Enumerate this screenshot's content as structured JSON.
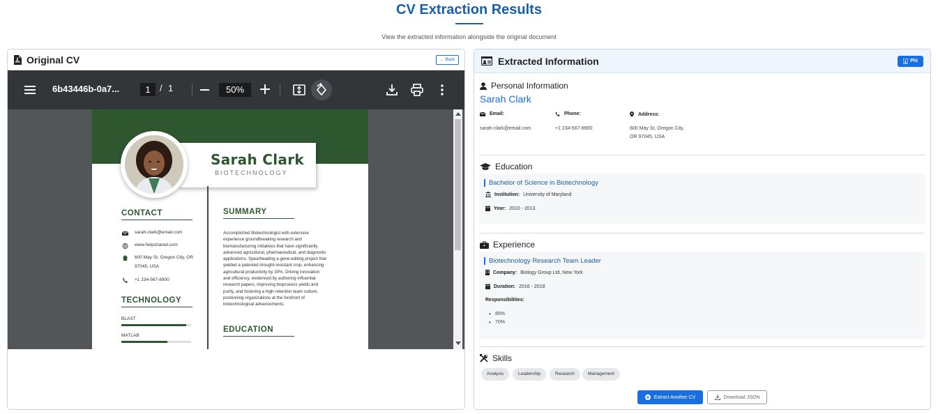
{
  "header": {
    "title": "CV Extraction Results",
    "subtitle": "View the extracted information alongside the original document"
  },
  "left_panel": {
    "title": "Original CV",
    "back_label": "Back",
    "pdf_toolbar": {
      "file_name": "6b43446b-0a7...",
      "current_page": "1",
      "page_separator": "/",
      "total_pages": "1",
      "zoom": "50%"
    },
    "cv": {
      "name": "Sarah Clark",
      "role": "BIOTECHNOLOGY",
      "contact_heading": "CONTACT",
      "contact": {
        "email": "sarah-clark@email.com",
        "website": "www.helpshared.com",
        "address_line1": "600 May St, Oregon City, OR",
        "address_line2": "97045, USA",
        "phone": "+1 234-567-8900"
      },
      "technology_heading": "TECHNOLOGY",
      "skills": [
        {
          "name": "BLAST",
          "level": 0.93
        },
        {
          "name": "MATLAB",
          "level": 0.66
        }
      ],
      "summary_heading": "SUMMARY",
      "summary_lines": [
        "Accomplished Biotechnologist with extensive",
        "experience groundbreaking research and",
        "biomanufacturing initiatives that have significantly",
        "advanced agricultural, pharmaceutical, and diagnostic",
        "applications. Spearheading a gene-editing project that",
        "yielded a patented drought-resistant crop, enhancing",
        "agricultural productivity by 30%. Driving innovation",
        "and efficiency, evidenced by authoring influential",
        "research papers, improving bioprocess yields and",
        "purity, and fostering a high-retention team culture,",
        "positioning organizations at the forefront of",
        "biotechnological advancements."
      ],
      "education_heading": "EDUCATION"
    }
  },
  "right_panel": {
    "title": "Extracted Information",
    "phi_label": "Phi",
    "personal": {
      "heading": "Personal Information",
      "name": "Sarah Clark",
      "email_label": "Email:",
      "email": "sarah-clark@email.com",
      "phone_label": "Phone:",
      "phone": "+1 234-567-8900",
      "address_label": "Address:",
      "address_line1": "600 May St, Oregon City,",
      "address_line2": "OR 97045, USA"
    },
    "education": {
      "heading": "Education",
      "degree": "Bachelor of Science in Biotechnology",
      "institution_label": "Institution:",
      "institution": "University of Maryland",
      "year_label": "Year:",
      "year": "2010 - 2013"
    },
    "experience": {
      "heading": "Experience",
      "title": "Biotechnology Research Team Leader",
      "company_label": "Company:",
      "company": "Biology Group Ltd, New York",
      "duration_label": "Duration:",
      "duration": "2016 - 2018",
      "responsibilities_label": "Responsibilities:",
      "responsibilities": [
        "85%",
        "70%"
      ]
    },
    "skills": {
      "heading": "Skills",
      "items": [
        "Analysis",
        "Leadership",
        "Research",
        "Management"
      ]
    },
    "actions": {
      "extract_label": "Extract Another CV",
      "download_label": "Download JSON"
    }
  }
}
